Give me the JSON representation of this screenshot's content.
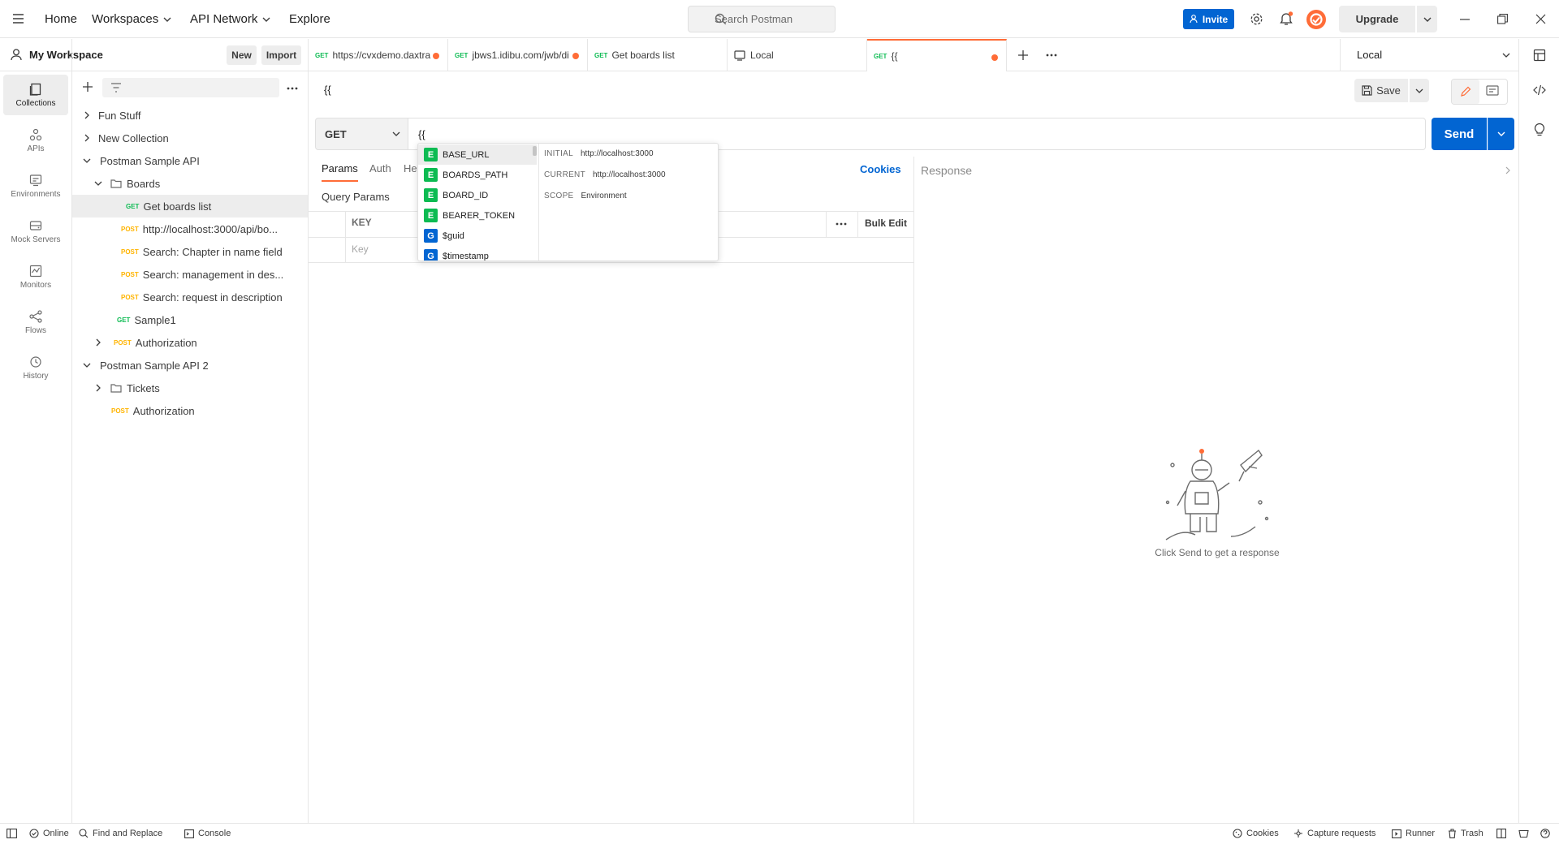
{
  "topbar": {
    "nav": [
      "Home",
      "Workspaces",
      "API Network",
      "Explore"
    ],
    "search_placeholder": "Search Postman",
    "invite_label": "Invite",
    "upgrade_label": "Upgrade"
  },
  "workspace": {
    "name": "My Workspace",
    "new_label": "New",
    "import_label": "Import"
  },
  "rail": [
    {
      "label": "Collections",
      "icon": "collections-icon"
    },
    {
      "label": "APIs",
      "icon": "apis-icon"
    },
    {
      "label": "Environments",
      "icon": "environments-icon"
    },
    {
      "label": "Mock Servers",
      "icon": "mock-servers-icon"
    },
    {
      "label": "Monitors",
      "icon": "monitors-icon"
    },
    {
      "label": "Flows",
      "icon": "flows-icon"
    },
    {
      "label": "History",
      "icon": "history-icon"
    }
  ],
  "tree": [
    {
      "label": "Fun Stuff",
      "method": "",
      "type": "collection",
      "expanded": false
    },
    {
      "label": "New Collection",
      "method": "",
      "type": "collection",
      "expanded": false
    },
    {
      "label": "Postman Sample API",
      "method": "",
      "type": "collection",
      "expanded": true
    },
    {
      "label": "Boards",
      "method": "",
      "type": "folder",
      "expanded": true
    },
    {
      "label": "Get boards list",
      "method": "GET",
      "type": "request",
      "selected": true
    },
    {
      "label": "http://localhost:3000/api/bo...",
      "method": "POST",
      "type": "request"
    },
    {
      "label": "Search: Chapter in name field",
      "method": "POST",
      "type": "request"
    },
    {
      "label": "Search: management in des...",
      "method": "POST",
      "type": "request"
    },
    {
      "label": "Search: request in description",
      "method": "POST",
      "type": "request"
    },
    {
      "label": "Sample1",
      "method": "GET",
      "type": "request"
    },
    {
      "label": "Authorization",
      "method": "POST",
      "type": "folder-request",
      "expanded": false
    },
    {
      "label": "Postman Sample API 2",
      "method": "",
      "type": "collection",
      "expanded": true
    },
    {
      "label": "Tickets",
      "method": "",
      "type": "folder",
      "expanded": false
    },
    {
      "label": "Authorization",
      "method": "POST",
      "type": "request"
    }
  ],
  "tabs": [
    {
      "method": "GET",
      "label": "https://cvxdemo.daxtra",
      "dirty": true,
      "icon": ""
    },
    {
      "method": "GET",
      "label": "jbws1.idibu.com/jwb/di",
      "dirty": true,
      "icon": ""
    },
    {
      "method": "GET",
      "label": "Get boards list",
      "dirty": false,
      "icon": ""
    },
    {
      "method": "",
      "label": "Local",
      "dirty": false,
      "icon": "environment-icon"
    },
    {
      "method": "GET",
      "label": "{{",
      "dirty": true,
      "icon": "",
      "active": true
    }
  ],
  "environment": "Local",
  "request": {
    "name": "{{",
    "method": "GET",
    "url": "{{",
    "send_label": "Send",
    "save_label": "Save",
    "tabs": [
      "Params",
      "Auth",
      "He"
    ],
    "cookies_label": "Cookies",
    "query_params_title": "Query Params",
    "key_header": "KEY",
    "bulk_edit_label": "Bulk Edit",
    "key_placeholder": "Key"
  },
  "autocomplete": {
    "items": [
      {
        "scope": "E",
        "name": "BASE_URL"
      },
      {
        "scope": "E",
        "name": "BOARDS_PATH"
      },
      {
        "scope": "E",
        "name": "BOARD_ID"
      },
      {
        "scope": "E",
        "name": "BEARER_TOKEN"
      },
      {
        "scope": "G",
        "name": "$guid"
      },
      {
        "scope": "G",
        "name": "$timestamp"
      }
    ],
    "initial_label": "INITIAL",
    "initial_value": "http://localhost:3000",
    "current_label": "CURRENT",
    "current_value": "http://localhost:3000",
    "scope_label": "SCOPE",
    "scope_value": "Environment"
  },
  "response": {
    "title": "Response",
    "empty_text": "Click Send to get a response"
  },
  "statusbar": {
    "left": [
      "Online",
      "Find and Replace",
      "Console"
    ],
    "right": [
      "Cookies",
      "Capture requests",
      "Runner",
      "Trash"
    ]
  },
  "colors": {
    "accent": "#ff6c37",
    "primary": "#0265d2",
    "get": "#0cbb52",
    "post": "#ffb400"
  }
}
